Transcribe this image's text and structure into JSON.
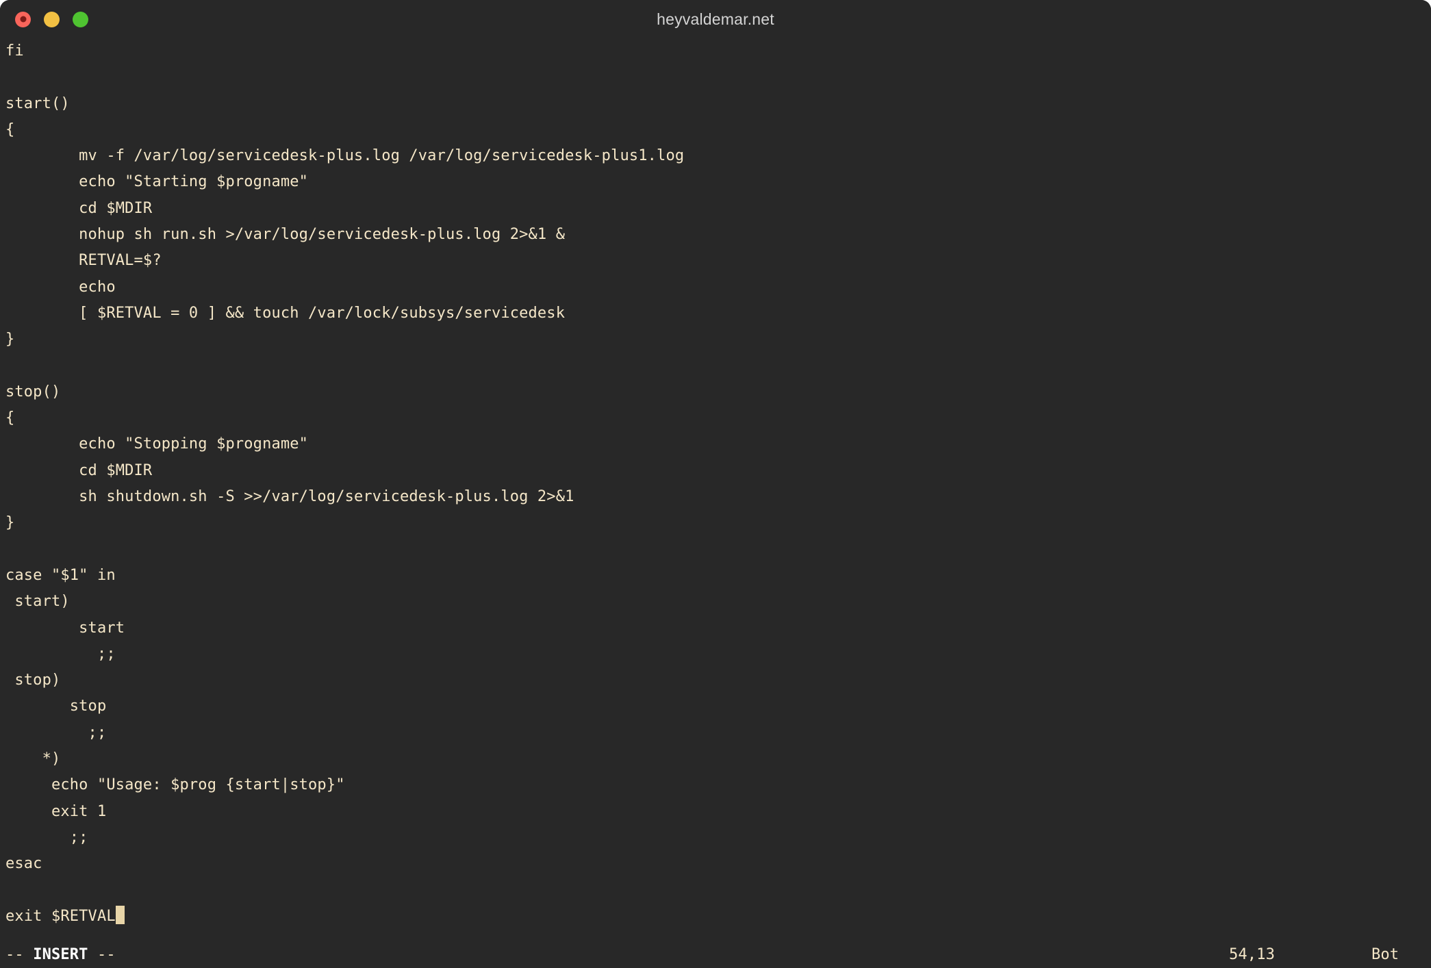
{
  "window": {
    "title": "heyvaldemar.net",
    "background_color": "#282828",
    "foreground_color": "#f5e7c8",
    "controls": [
      {
        "name": "close",
        "color": "#f9655b",
        "label": "Close"
      },
      {
        "name": "minimize",
        "color": "#f2c043",
        "label": "Minimize"
      },
      {
        "name": "maximize",
        "color": "#4fc331",
        "label": "Maximize"
      }
    ]
  },
  "editor": {
    "application": "vim",
    "lines": [
      "fi",
      "",
      "start()",
      "{",
      "        mv -f /var/log/servicedesk-plus.log /var/log/servicedesk-plus1.log",
      "        echo \"Starting $progname\"",
      "        cd $MDIR",
      "        nohup sh run.sh >/var/log/servicedesk-plus.log 2>&1 &",
      "        RETVAL=$?",
      "        echo",
      "        [ $RETVAL = 0 ] && touch /var/lock/subsys/servicedesk",
      "}",
      "",
      "stop()",
      "{",
      "        echo \"Stopping $progname\"",
      "        cd $MDIR",
      "        sh shutdown.sh -S >>/var/log/servicedesk-plus.log 2>&1",
      "}",
      "",
      "case \"$1\" in",
      " start)",
      "        start",
      "          ;;",
      " stop)",
      "       stop",
      "         ;;",
      "    *)",
      "     echo \"Usage: $prog {start|stop}\"",
      "     exit 1",
      "       ;;",
      "esac",
      "",
      "exit $RETVAL"
    ],
    "cursor": {
      "line_text": "exit $RETVAL",
      "color": "#e8d5a8"
    }
  },
  "statusbar": {
    "mode_prefix": "-- ",
    "mode": "INSERT",
    "mode_suffix": " --",
    "position": "54,13",
    "scroll": "Bot"
  }
}
